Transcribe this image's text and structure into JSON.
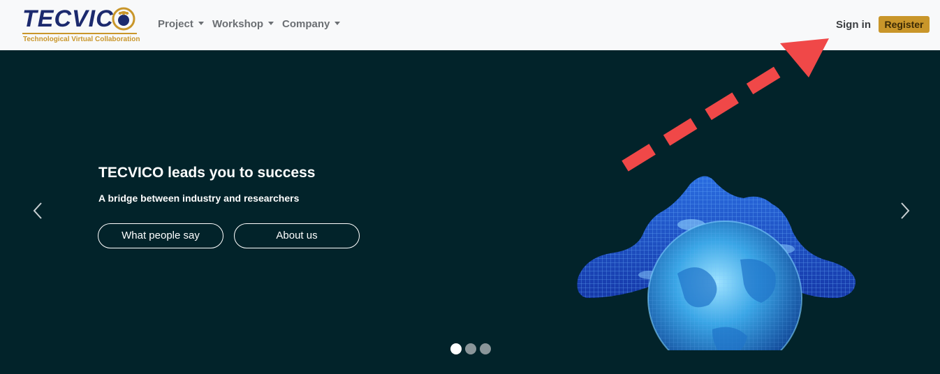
{
  "brand": {
    "name": "TECVIC",
    "tagline": "Technological Virtual Collaboration",
    "primary_color": "#1c2a6e",
    "accent_color": "#c9962a"
  },
  "nav": {
    "items": [
      {
        "label": "Project",
        "icon": "caret-down-icon"
      },
      {
        "label": "Workshop",
        "icon": "caret-down-icon"
      },
      {
        "label": "Company",
        "icon": "caret-down-icon"
      }
    ],
    "signin_label": "Sign in",
    "register_label": "Register"
  },
  "hero": {
    "title": "TECVICO leads you to success",
    "subtitle": "A bridge between industry and researchers",
    "buttons": [
      {
        "label": "What people say"
      },
      {
        "label": "About us"
      }
    ],
    "prev_icon": "chevron-left-icon",
    "next_icon": "chevron-right-icon",
    "image": "wireframe-hand-globe",
    "background_color": "#02232a"
  },
  "carousel": {
    "slide_count": 3,
    "active_index": 0
  },
  "annotation": {
    "icon": "dashed-arrow-icon",
    "color": "#f04848"
  }
}
